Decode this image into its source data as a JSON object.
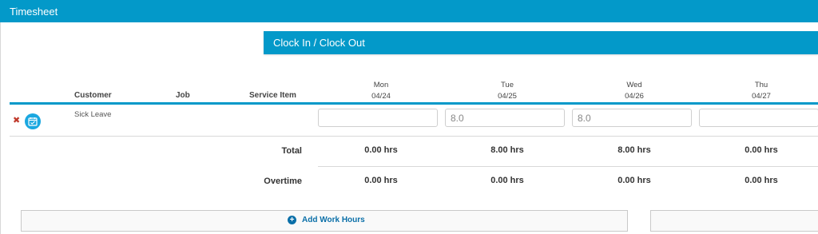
{
  "app": {
    "title": "Timesheet"
  },
  "clock": {
    "label": "Clock In / Clock Out"
  },
  "columns": {
    "customer": "Customer",
    "job": "Job",
    "service_item": "Service Item"
  },
  "days": [
    {
      "name": "Mon",
      "date": "04/24"
    },
    {
      "name": "Tue",
      "date": "04/25"
    },
    {
      "name": "Wed",
      "date": "04/26"
    },
    {
      "name": "Thu",
      "date": "04/27"
    }
  ],
  "entry": {
    "service_item": "Sick Leave",
    "hours": [
      "",
      "8.0",
      "8.0",
      ""
    ]
  },
  "totals": {
    "label": "Total",
    "values": [
      "0.00 hrs",
      "8.00 hrs",
      "8.00 hrs",
      "0.00 hrs"
    ]
  },
  "overtime": {
    "label": "Overtime",
    "values": [
      "0.00 hrs",
      "0.00 hrs",
      "0.00 hrs",
      "0.00 hrs"
    ]
  },
  "actions": {
    "add_work_hours": "Add Work Hours"
  },
  "colors": {
    "accent": "#0399c9",
    "delete": "#c0392b",
    "link": "#0a6fa8"
  },
  "icons": {
    "delete": "close-icon",
    "calendar": "calendar-icon",
    "add": "plus-circle-icon"
  }
}
